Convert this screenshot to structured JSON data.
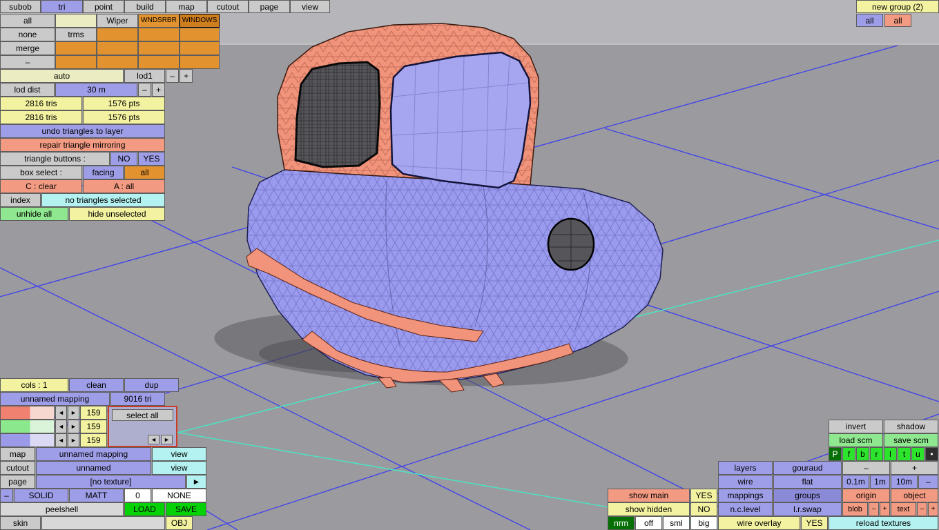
{
  "menu": {
    "items": [
      "subob",
      "tri",
      "point",
      "build",
      "map",
      "cutout",
      "page",
      "view"
    ]
  },
  "top_right": {
    "new_group": "new group (2)",
    "all_left": "all",
    "all_right": "all"
  },
  "grid": {
    "r1c1": "all",
    "r1c3": "Wiper",
    "r1c4": "WNDSRBR",
    "r1c5": "WINDOWS",
    "r2c1": "none",
    "r2c2": "trms",
    "r3c1": "merge",
    "r4c1": "–"
  },
  "lod": {
    "auto": "auto",
    "lod1": "lod1",
    "minus": "–",
    "plus": "+",
    "dist_label": "lod dist",
    "dist_value": "30 m",
    "dist_minus": "–",
    "dist_plus": "+"
  },
  "stats": {
    "tris1": "2816 tris",
    "pts1": "1576 pts",
    "tris2": "2816 tris",
    "pts2": "1576 pts"
  },
  "actions": {
    "undo": "undo triangles to layer",
    "repair": "repair triangle mirroring",
    "tri_buttons_label": "triangle buttons :",
    "no": "NO",
    "yes": "YES",
    "box_select_label": "box select :",
    "facing": "facing",
    "all": "all",
    "c_clear": "C : clear",
    "a_all": "A : all",
    "index": "index",
    "no_tri": "no triangles selected",
    "unhide": "unhide all",
    "hide_unselected": "hide unselected"
  },
  "mapping": {
    "cols": "cols : 1",
    "clean": "clean",
    "dup": "dup",
    "name": "unnamed mapping",
    "tri_count": "9016 tri",
    "ch1": "159",
    "ch2": "159",
    "ch3": "159",
    "select_all": "select all",
    "left_arrow": "◄",
    "right_arrow": "►"
  },
  "layers_panel": {
    "map": "map",
    "map_value": "unnamed mapping",
    "map_view": "view",
    "cutout": "cutout",
    "cutout_value": "unnamed",
    "cutout_view": "view",
    "page": "page",
    "page_value": "[no texture]",
    "page_arrow": "►",
    "minus": "–",
    "solid": "SOLID",
    "matt": "MATT",
    "zero": "0",
    "none": "NONE",
    "file": "peelshell",
    "load": "LOAD",
    "save": "SAVE",
    "skin": "skin",
    "obj": "OBJ"
  },
  "right_panel": {
    "invert": "invert",
    "shadow": "shadow",
    "load_scm": "load scm",
    "save_scm": "save scm",
    "letters": [
      "P",
      "f",
      "b",
      "r",
      "l",
      "t",
      "u",
      "•"
    ],
    "layers": "layers",
    "gouraud": "gouraud",
    "layers_minus": "–",
    "layers_plus": "+",
    "wire": "wire",
    "flat": "flat",
    "m01": "0.1m",
    "m1": "1m",
    "m10": "10m",
    "wire_minus": "–",
    "show_main": "show main",
    "show_main_yes": "YES",
    "mappings": "mappings",
    "groups": "groups",
    "origin": "origin",
    "object": "object",
    "show_hidden": "show hidden",
    "show_hidden_no": "NO",
    "nclevel": "n.c.level",
    "lrswap": "l.r.swap",
    "blob": "blob",
    "blob_minus": "–",
    "blob_plus": "+",
    "text": "text",
    "text_minus": "–",
    "text_plus": "+",
    "nrm": "nrm",
    "off": "off",
    "sml": "sml",
    "big": "big",
    "wire_overlay": "wire overlay",
    "wire_overlay_yes": "YES",
    "reload": "reload textures"
  },
  "colors": {
    "body": "#9a9aee",
    "trim": "#f2937b",
    "grid_blue": "#4343ea",
    "grid_cyan": "#46e8c4"
  }
}
